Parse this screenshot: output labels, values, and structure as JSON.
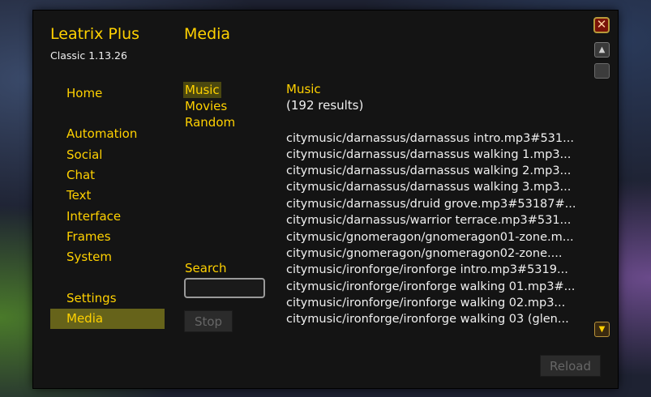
{
  "app": {
    "title": "Leatrix Plus",
    "version": "Classic 1.13.26"
  },
  "page": {
    "title": "Media"
  },
  "nav": {
    "home": "Home",
    "automation": "Automation",
    "social": "Social",
    "chat": "Chat",
    "text": "Text",
    "interface": "Interface",
    "frames": "Frames",
    "system": "System",
    "settings": "Settings",
    "media": "Media"
  },
  "categories": [
    "Music",
    "Movies",
    "Random"
  ],
  "list": {
    "title": "Music",
    "count": "(192 results)",
    "tracks": [
      "citymusic/darnassus/darnassus intro.mp3#531...",
      "citymusic/darnassus/darnassus walking 1.mp3...",
      "citymusic/darnassus/darnassus walking 2.mp3...",
      "citymusic/darnassus/darnassus walking 3.mp3...",
      "citymusic/darnassus/druid grove.mp3#53187#...",
      "citymusic/darnassus/warrior terrace.mp3#531...",
      "citymusic/gnomeragon/gnomeragon01-zone.m...",
      "citymusic/gnomeragon/gnomeragon02-zone....",
      "citymusic/ironforge/ironforge intro.mp3#5319...",
      "citymusic/ironforge/ironforge walking 01.mp3#...",
      "citymusic/ironforge/ironforge walking 02.mp3...",
      "citymusic/ironforge/ironforge walking 03 (glen..."
    ]
  },
  "search": {
    "label": "Search",
    "value": ""
  },
  "buttons": {
    "stop": "Stop",
    "reload": "Reload",
    "close": "✕"
  },
  "icons": {
    "close": "close-icon",
    "scroll_up": "scroll-up-icon",
    "scroll_down": "scroll-down-icon"
  },
  "colors": {
    "accent": "#ffd100",
    "nav_selected": "#66631a",
    "panel": "#141414"
  }
}
